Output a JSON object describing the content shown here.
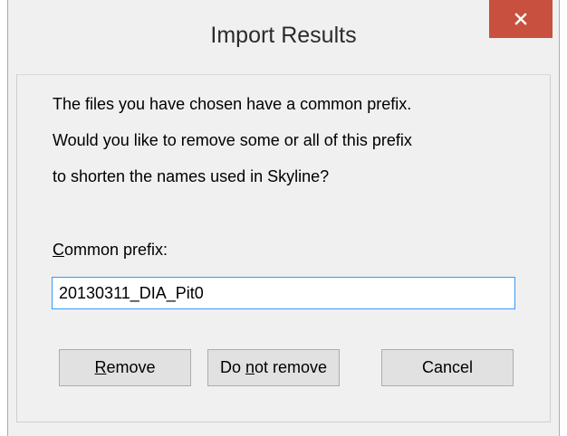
{
  "window": {
    "title": "Import Results",
    "close_icon": "close-icon",
    "close_color": "#c7503e"
  },
  "message": {
    "line1": "The files you have chosen have a common prefix.",
    "line2": "Would you like to remove some or all of this prefix",
    "line3": "to shorten the names used in Skyline?"
  },
  "prefix": {
    "label_accel": "C",
    "label_rest": "ommon prefix:",
    "value": "20130311_DIA_Pit0"
  },
  "buttons": {
    "remove_accel": "R",
    "remove_rest": "emove",
    "donot_pre": "Do ",
    "donot_accel": "n",
    "donot_rest": "ot remove",
    "cancel_label": "Cancel"
  },
  "colors": {
    "input_border": "#3399ff",
    "button_bg": "#e1e1e1",
    "dialog_bg": "#f0f0f0"
  }
}
